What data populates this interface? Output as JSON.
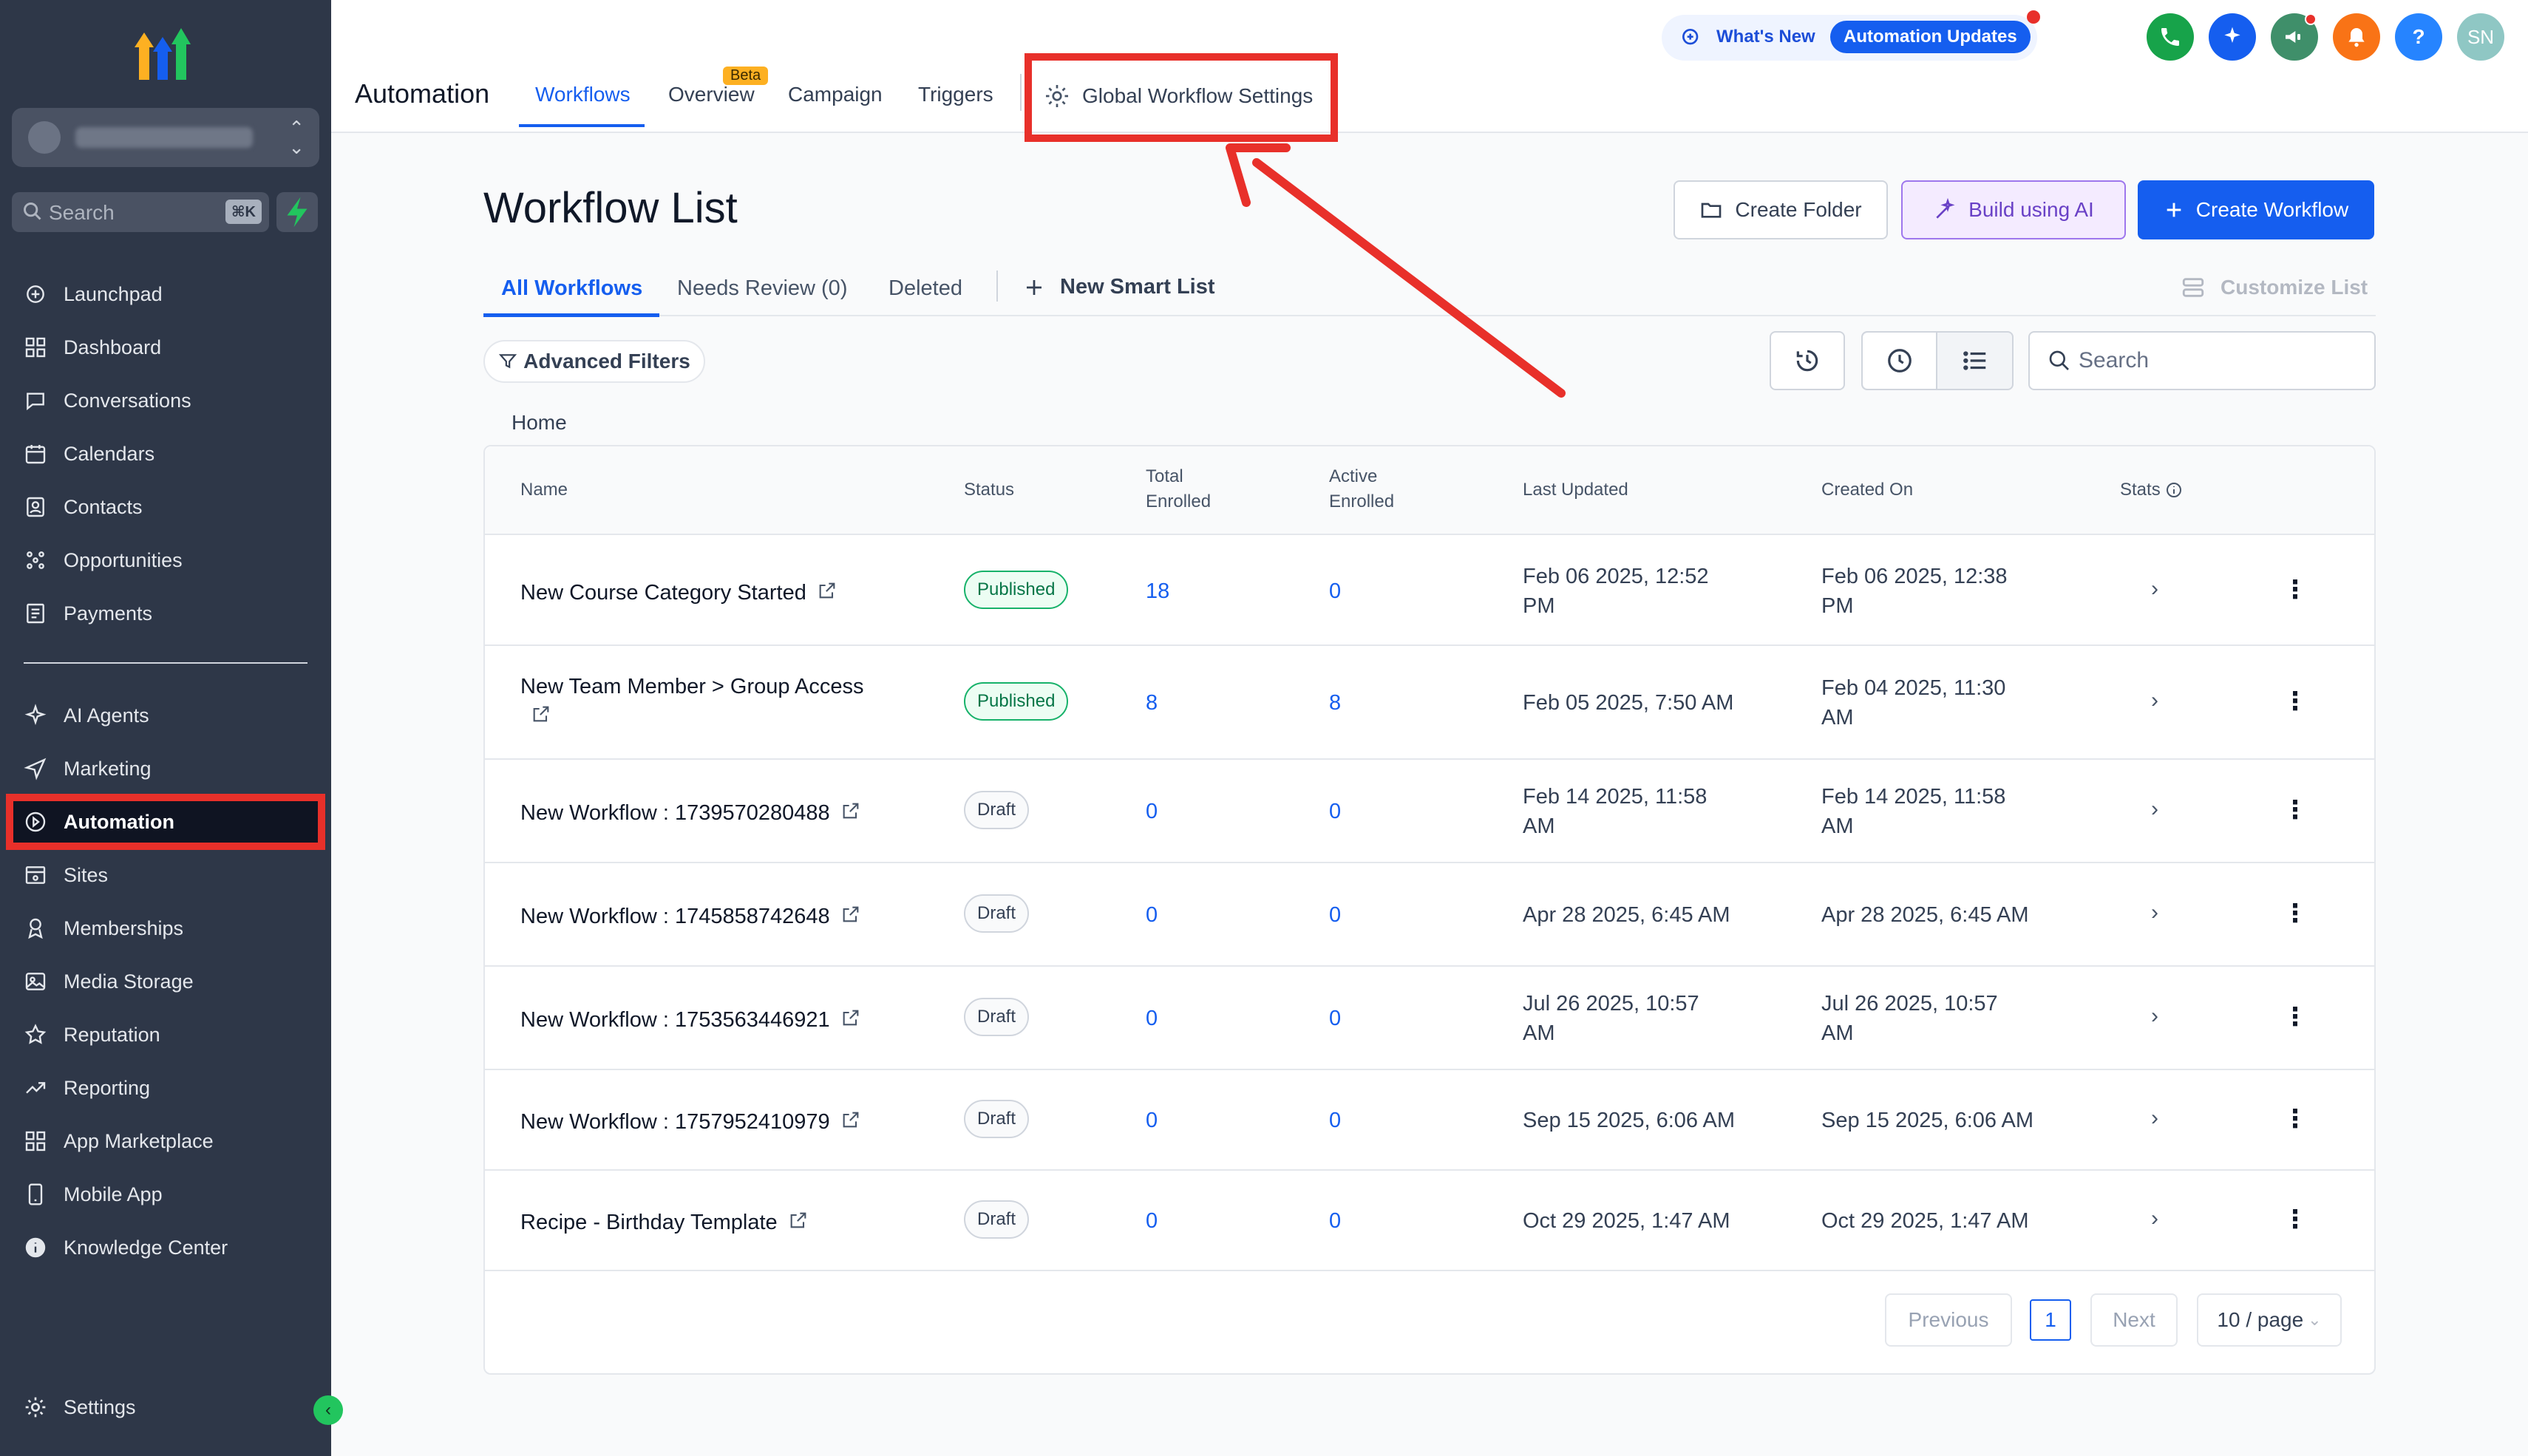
{
  "sidebar": {
    "search_label": "Search",
    "search_shortcut": "⌘K",
    "items_top": [
      {
        "label": "Launchpad",
        "icon": "launchpad-icon"
      },
      {
        "label": "Dashboard",
        "icon": "dashboard-icon"
      },
      {
        "label": "Conversations",
        "icon": "chat-icon"
      },
      {
        "label": "Calendars",
        "icon": "calendar-icon"
      },
      {
        "label": "Contacts",
        "icon": "contacts-icon"
      },
      {
        "label": "Opportunities",
        "icon": "opportunities-icon"
      },
      {
        "label": "Payments",
        "icon": "payments-icon"
      }
    ],
    "items_bottom": [
      {
        "label": "AI Agents",
        "icon": "sparkle-icon"
      },
      {
        "label": "Marketing",
        "icon": "send-icon"
      },
      {
        "label": "Automation",
        "icon": "automation-icon"
      },
      {
        "label": "Sites",
        "icon": "sites-icon"
      },
      {
        "label": "Memberships",
        "icon": "membership-icon"
      },
      {
        "label": "Media Storage",
        "icon": "image-icon"
      },
      {
        "label": "Reputation",
        "icon": "star-icon"
      },
      {
        "label": "Reporting",
        "icon": "trend-icon"
      },
      {
        "label": "App Marketplace",
        "icon": "grid-icon"
      },
      {
        "label": "Mobile App",
        "icon": "mobile-icon"
      },
      {
        "label": "Knowledge Center",
        "icon": "info-icon"
      }
    ],
    "settings_label": "Settings"
  },
  "topbar": {
    "app_title": "Automation",
    "tabs": [
      "Workflows",
      "Overview",
      "Campaign",
      "Triggers"
    ],
    "beta_label": "Beta",
    "global_settings_label": "Global Workflow Settings",
    "whats_new": "What's New",
    "automation_updates": "Automation Updates",
    "user_initials": "SN",
    "help_label": "?"
  },
  "main": {
    "title": "Workflow List",
    "create_folder": "Create Folder",
    "build_ai": "Build using AI",
    "create_workflow": "Create Workflow",
    "subtabs": [
      "All Workflows",
      "Needs Review (0)",
      "Deleted"
    ],
    "new_smart_list": "New Smart List",
    "customize_list": "Customize List",
    "advanced_filters": "Advanced Filters",
    "search_placeholder": "Search",
    "breadcrumb": "Home"
  },
  "table": {
    "headers": {
      "name": "Name",
      "status": "Status",
      "total_enrolled": [
        "Total",
        "Enrolled"
      ],
      "active_enrolled": [
        "Active",
        "Enrolled"
      ],
      "last_updated": "Last Updated",
      "created_on": "Created On",
      "stats": "Stats"
    },
    "rows": [
      {
        "name": "New Course Category Started",
        "status": "Published",
        "total": "18",
        "active": "0",
        "updated": [
          "Feb 06 2025, 12:52",
          "PM"
        ],
        "created": [
          "Feb 06 2025, 12:38",
          "PM"
        ]
      },
      {
        "name": "New Team Member > Group Access",
        "status": "Published",
        "total": "8",
        "active": "8",
        "updated": [
          "Feb 05 2025, 7:50 AM",
          ""
        ],
        "created": [
          "Feb 04 2025, 11:30",
          "AM"
        ]
      },
      {
        "name": "New Workflow : 1739570280488",
        "status": "Draft",
        "total": "0",
        "active": "0",
        "updated": [
          "Feb 14 2025, 11:58",
          "AM"
        ],
        "created": [
          "Feb 14 2025, 11:58",
          "AM"
        ]
      },
      {
        "name": "New Workflow : 1745858742648",
        "status": "Draft",
        "total": "0",
        "active": "0",
        "updated": [
          "Apr 28 2025, 6:45 AM",
          ""
        ],
        "created": [
          "Apr 28 2025, 6:45 AM",
          ""
        ]
      },
      {
        "name": "New Workflow : 1753563446921",
        "status": "Draft",
        "total": "0",
        "active": "0",
        "updated": [
          "Jul 26 2025, 10:57",
          "AM"
        ],
        "created": [
          "Jul 26 2025, 10:57",
          "AM"
        ]
      },
      {
        "name": "New Workflow : 1757952410979",
        "status": "Draft",
        "total": "0",
        "active": "0",
        "updated": [
          "Sep 15 2025, 6:06 AM",
          ""
        ],
        "created": [
          "Sep 15 2025, 6:06 AM",
          ""
        ]
      },
      {
        "name": "Recipe - Birthday Template",
        "status": "Draft",
        "total": "0",
        "active": "0",
        "updated": [
          "Oct 29 2025, 1:47 AM",
          ""
        ],
        "created": [
          "Oct 29 2025, 1:47 AM",
          ""
        ]
      }
    ]
  },
  "pagination": {
    "previous": "Previous",
    "page": "1",
    "next": "Next",
    "page_size": "10 / page"
  },
  "colors": {
    "accent": "#155eef",
    "sidebar_bg": "#2e3748",
    "highlight_red": "#e8302a",
    "published_green": "#17b26a"
  }
}
